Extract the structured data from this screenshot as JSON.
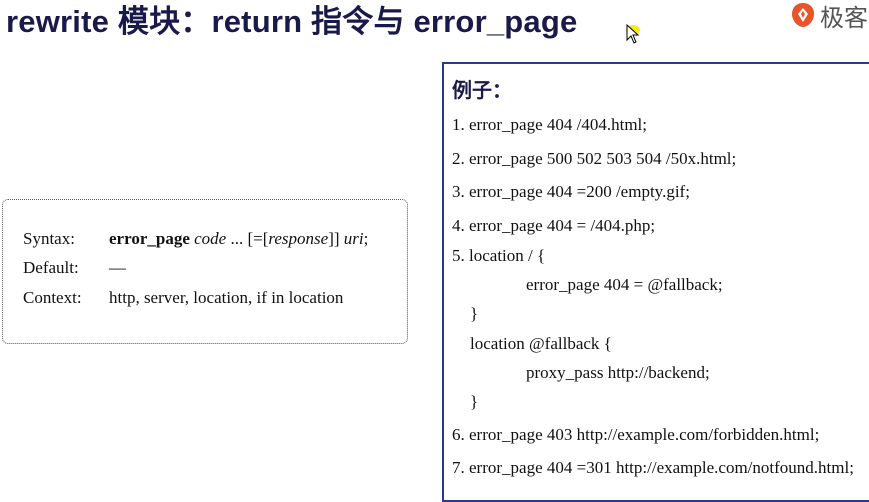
{
  "slide": {
    "title": "rewrite 模块：return 指令与 error_page",
    "logo_text": "极客"
  },
  "syntax": {
    "rows": [
      {
        "key": "Syntax:",
        "directive": "error_page",
        "code": "code",
        "rest1": " ... [=[",
        "response": "response",
        "rest2": "]] ",
        "uri": "uri",
        "tail": ";"
      },
      {
        "key": "Default:",
        "value": "—"
      },
      {
        "key": "Context:",
        "value": "http, server, location, if in location"
      }
    ]
  },
  "example": {
    "title": "例子：",
    "lines": [
      "1. error_page 404 /404.html;",
      "2. error_page 500 502 503 504 /50x.html;",
      "3. error_page 404 =200 /empty.gif;",
      "4. error_page 404 = /404.php;",
      "5. location / {",
      "error_page 404 = @fallback;",
      "}",
      "location @fallback {",
      "proxy_pass http://backend;",
      "}",
      "6. error_page 403 http://example.com/forbidden.html;",
      "7. error_page 404 =301 http://example.com/notfound.html;"
    ]
  }
}
